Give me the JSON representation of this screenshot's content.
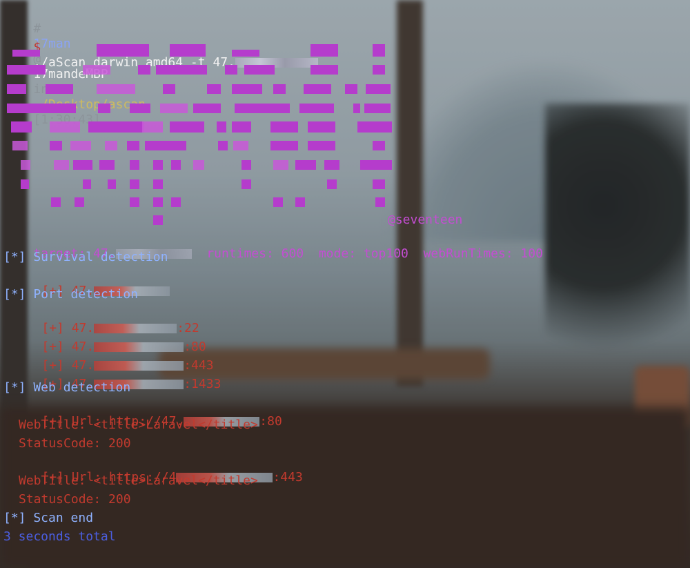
{
  "prompt": {
    "hash": "#",
    "user": "17man",
    "at": "@",
    "host": "17mandeMBP",
    "in": "in",
    "path": "~/Desktop/ascan",
    "time": "[1:30:43]"
  },
  "command": {
    "dollar": "$",
    "text": "./aScan_darwin_amd64 -t 47."
  },
  "banner": {
    "author": "@seventeen"
  },
  "summary": {
    "target_label": "target: 47.",
    "runtimes": "runtimes: 600",
    "mode": "mode: top100",
    "web_run_times": "webRunTimes: 100"
  },
  "survival": {
    "header": "[*] Survival detection",
    "hit": "[+] 47."
  },
  "port": {
    "header": "[*] Port detection",
    "hits": [
      {
        "prefix": "[+] 47.",
        "port": ":22"
      },
      {
        "prefix": "[+] 47.",
        "port": ":80"
      },
      {
        "prefix": "[+] 47.",
        "port": ":443"
      },
      {
        "prefix": "[+] 47.",
        "port": ":1433"
      }
    ]
  },
  "web": {
    "header": "[*] Web detection",
    "results": [
      {
        "url_prefix": "[+] Url: http://47.",
        "port": ":80",
        "title": "WebTitle: <title>Laravel</title>",
        "status": "StatusCode: 200"
      },
      {
        "url_prefix": "[+] Url: https://4",
        "port": ":443",
        "title": "WebTitle: <title>Laravel</title>",
        "status": "StatusCode: 200"
      }
    ]
  },
  "end": {
    "header": "[*] Scan end",
    "total": "3 seconds total"
  },
  "colors": {
    "magenta": "#c44dd3",
    "red": "#c23a2e",
    "blue": "#8aa3f5",
    "gray": "#8c949a"
  }
}
